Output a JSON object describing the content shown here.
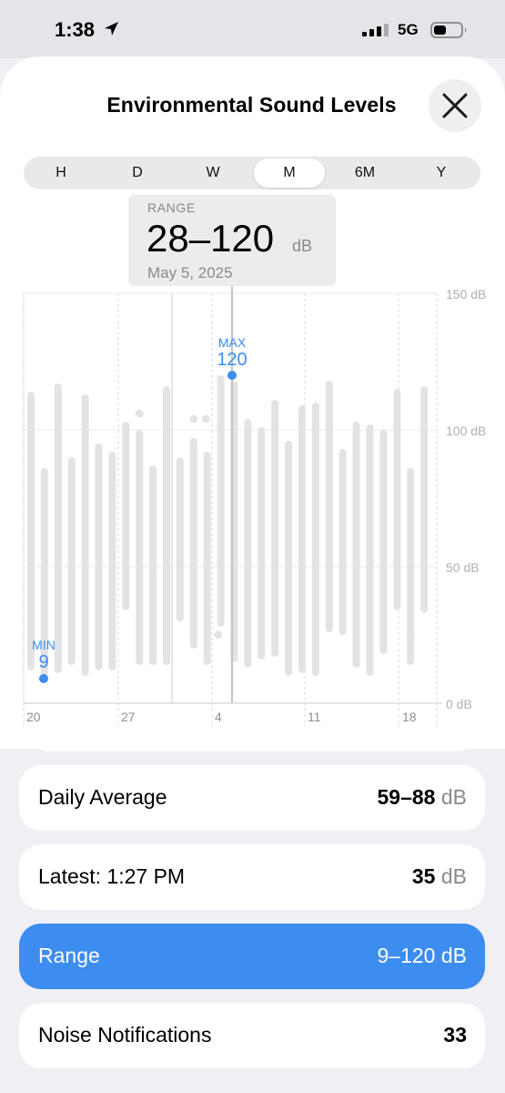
{
  "status": {
    "time": "1:38",
    "network": "5G"
  },
  "header": {
    "title": "Environmental Sound Levels"
  },
  "tabs": [
    {
      "label": "H",
      "active": false
    },
    {
      "label": "D",
      "active": false
    },
    {
      "label": "W",
      "active": false
    },
    {
      "label": "M",
      "active": true
    },
    {
      "label": "6M",
      "active": false
    },
    {
      "label": "Y",
      "active": false
    }
  ],
  "tooltip": {
    "label": "RANGE",
    "value": "28–120",
    "unit": "dB",
    "date": "May 5, 2025"
  },
  "chart_data": {
    "type": "bar",
    "y_unit": "dB",
    "ylim": [
      0,
      150
    ],
    "y_ticks": [
      "150 dB",
      "100 dB",
      "50 dB",
      "0 dB"
    ],
    "x_ticks": [
      "20",
      "27",
      "4",
      "11",
      "18"
    ],
    "grid": true,
    "selected_day": "May 5, 2025",
    "series": [
      {
        "values": [
          {
            "min": 12,
            "max": 114
          },
          {
            "min": 10,
            "max": 86
          },
          {
            "min": 11,
            "max": 117
          },
          {
            "min": 14,
            "max": 90
          },
          {
            "min": 10,
            "max": 113
          },
          {
            "min": 12,
            "max": 95
          },
          {
            "min": 12,
            "max": 92
          },
          {
            "min": 34,
            "max": 103
          },
          {
            "min": 14,
            "max": 100
          },
          {
            "min": 14,
            "max": 87
          },
          {
            "min": 14,
            "max": 116
          },
          {
            "min": 30,
            "max": 90
          },
          {
            "min": 20,
            "max": 97
          },
          {
            "min": 14,
            "max": 92
          },
          {
            "min": 28,
            "max": 120
          },
          {
            "min": 15,
            "max": 118
          },
          {
            "min": 13,
            "max": 104
          },
          {
            "min": 16,
            "max": 101
          },
          {
            "min": 17,
            "max": 111
          },
          {
            "min": 10,
            "max": 96
          },
          {
            "min": 11,
            "max": 109
          },
          {
            "min": 10,
            "max": 110
          },
          {
            "min": 26,
            "max": 118
          },
          {
            "min": 25,
            "max": 93
          },
          {
            "min": 13,
            "max": 103
          },
          {
            "min": 10,
            "max": 102
          },
          {
            "min": 18,
            "max": 100
          },
          {
            "min": 34,
            "max": 115
          },
          {
            "min": 14,
            "max": 86
          },
          {
            "min": 33,
            "max": 116
          }
        ]
      }
    ],
    "isolated_points": [
      106,
      104,
      104,
      25,
      25
    ],
    "annotations": [
      {
        "label": "MAX",
        "value": "120"
      },
      {
        "label": "MIN",
        "value": "9"
      }
    ]
  },
  "stats": [
    {
      "label": "Daily Average",
      "value": "59–88",
      "unit": "dB",
      "highlighted": false
    },
    {
      "label": "Latest: 1:27 PM",
      "value": "35",
      "unit": "dB",
      "highlighted": false
    },
    {
      "label": "Range",
      "value": "9–120 dB",
      "unit": "",
      "highlighted": true
    },
    {
      "label": "Noise Notifications",
      "value": "33",
      "unit": "",
      "highlighted": false
    }
  ],
  "colors": {
    "accent": "#3d8cf0",
    "bar": "#e3e3e6",
    "selected_line": "#c6c6c9",
    "background": "#efeff4"
  }
}
